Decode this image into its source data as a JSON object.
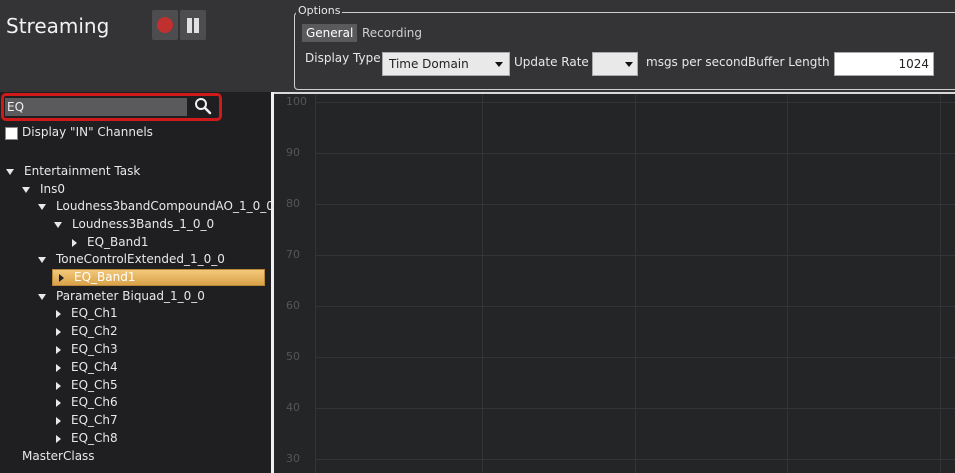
{
  "app": {
    "title": "Streaming"
  },
  "options": {
    "legend": "Options",
    "tabs": [
      "General",
      "Recording"
    ],
    "display_type_label": "Display Type :",
    "display_type_value": "Time Domain",
    "update_rate_label": "Update Rate :",
    "update_rate_value": "",
    "msgs_label": "msgs per second.",
    "buffer_length_label": "Buffer Length :",
    "buffer_length_value": "1024"
  },
  "search": {
    "value": "EQ"
  },
  "display_in": {
    "label": "Display \"IN\" Channels",
    "checked": false
  },
  "tree": [
    {
      "label": "Entertainment Task",
      "expanded": true
    },
    {
      "label": "Ins0",
      "expanded": true
    },
    {
      "label": "Loudness3bandCompoundAO_1_0_0",
      "expanded": true
    },
    {
      "label": "Loudness3Bands_1_0_0",
      "expanded": true
    },
    {
      "label": "EQ_Band1",
      "expanded": false
    },
    {
      "label": "ToneControlExtended_1_0_0",
      "expanded": true
    },
    {
      "label": "EQ_Band1",
      "expanded": false,
      "selected": true
    },
    {
      "label": "Parameter Biquad_1_0_0",
      "expanded": true
    },
    {
      "label": "EQ_Ch1",
      "expanded": false
    },
    {
      "label": "EQ_Ch2",
      "expanded": false
    },
    {
      "label": "EQ_Ch3",
      "expanded": false
    },
    {
      "label": "EQ_Ch4",
      "expanded": false
    },
    {
      "label": "EQ_Ch5",
      "expanded": false
    },
    {
      "label": "EQ_Ch6",
      "expanded": false
    },
    {
      "label": "EQ_Ch7",
      "expanded": false
    },
    {
      "label": "EQ_Ch8",
      "expanded": false
    },
    {
      "label": "MasterClass",
      "expanded": null
    }
  ],
  "plot": {
    "y_ticks": [
      "100",
      "90",
      "80",
      "70",
      "60",
      "50",
      "40",
      "30"
    ]
  }
}
